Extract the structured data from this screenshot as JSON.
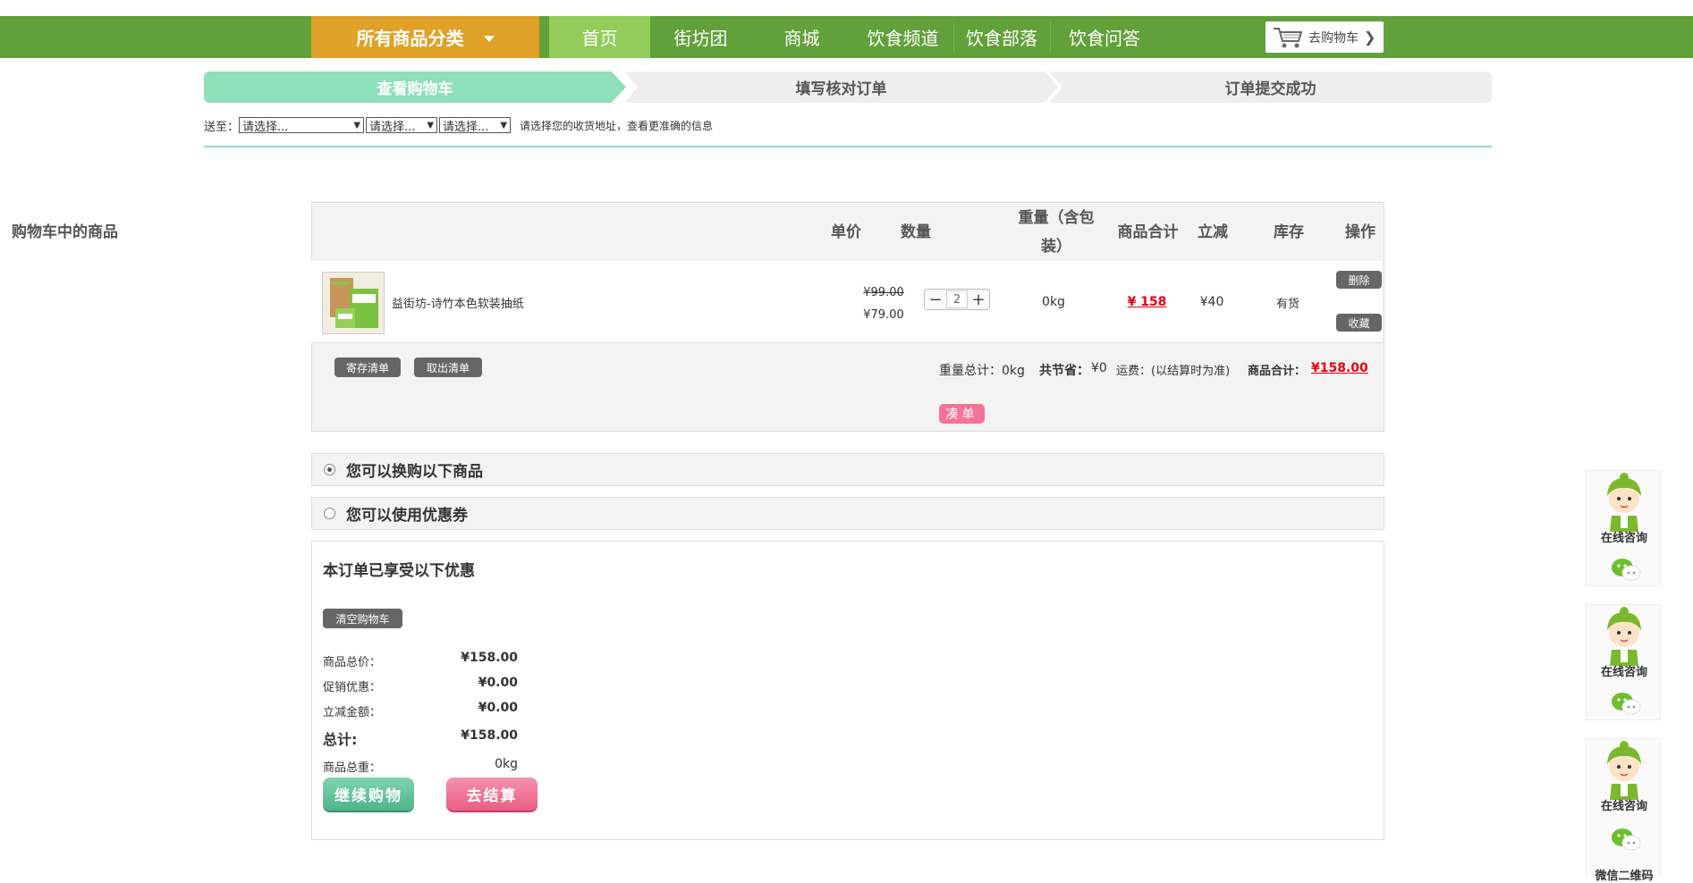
{
  "nav": {
    "category_label": "所有商品分类",
    "items": [
      {
        "label": "首页",
        "active": true
      },
      {
        "label": "街坊团"
      },
      {
        "label": "商城"
      },
      {
        "label": "饮食频道"
      },
      {
        "label": "饮食部落"
      },
      {
        "label": "饮食问答"
      }
    ],
    "cart_label": "去购物车"
  },
  "steps": [
    "查看购物车",
    "填写核对订单",
    "订单提交成功"
  ],
  "address": {
    "label": "送至：",
    "selects": [
      "请选择...",
      "请选择...",
      "请选择..."
    ],
    "hint": "请选择您的收货地址，查看更准确的信息"
  },
  "cart": {
    "headers": [
      "购物车中的商品",
      "单价",
      "数量",
      "重量（含包装）",
      "商品合计",
      "立减",
      "库存",
      "操作"
    ],
    "items": [
      {
        "name": "益街坊-诗竹本色软装抽纸",
        "original_price": "¥99.00",
        "price": "¥79.00",
        "quantity": "2",
        "weight": "0kg",
        "subtotal": "¥ 158",
        "discount": "¥40",
        "stock": "有货",
        "actions": [
          "删除",
          "收藏"
        ]
      }
    ],
    "footer": {
      "save_list": "寄存清单",
      "load_list": "取出清单",
      "weight_total": "重量总计：0kg",
      "saved_label": "共节省：",
      "saved_value": "¥0",
      "shipping": "运费：(以结算时为准)",
      "total_label": "商品合计：",
      "total_value": "¥158.00",
      "combine": "凑单"
    }
  },
  "options": [
    {
      "label": "您可以换购以下商品",
      "checked": true
    },
    {
      "label": "您可以使用优惠券",
      "checked": false
    }
  ],
  "discounts": {
    "title": "本订单已享受以下优惠",
    "clear_cart": "清空购物车",
    "rows": [
      {
        "label": "商品总价：",
        "value": "¥158.00"
      },
      {
        "label": "促销优惠：",
        "value": "¥0.00"
      },
      {
        "label": "立减金额：",
        "value": "¥0.00"
      }
    ],
    "total_label": "总计:",
    "total_value": "¥158.00",
    "weight_label": "商品总重：",
    "weight_value": "0kg",
    "continue_btn": "继续购物",
    "checkout_btn": "去结算"
  },
  "service": {
    "consult": "在线咨询",
    "wechat": "微信二维码"
  },
  "colors": {
    "nav_green": "#62a03a",
    "nav_active": "#93cc5a",
    "category_orange": "#dfa128",
    "step_active": "#8fdfba",
    "price_red": "#e60012",
    "checkout_pink": "#f06b8f",
    "continue_green": "#5cbf96"
  }
}
